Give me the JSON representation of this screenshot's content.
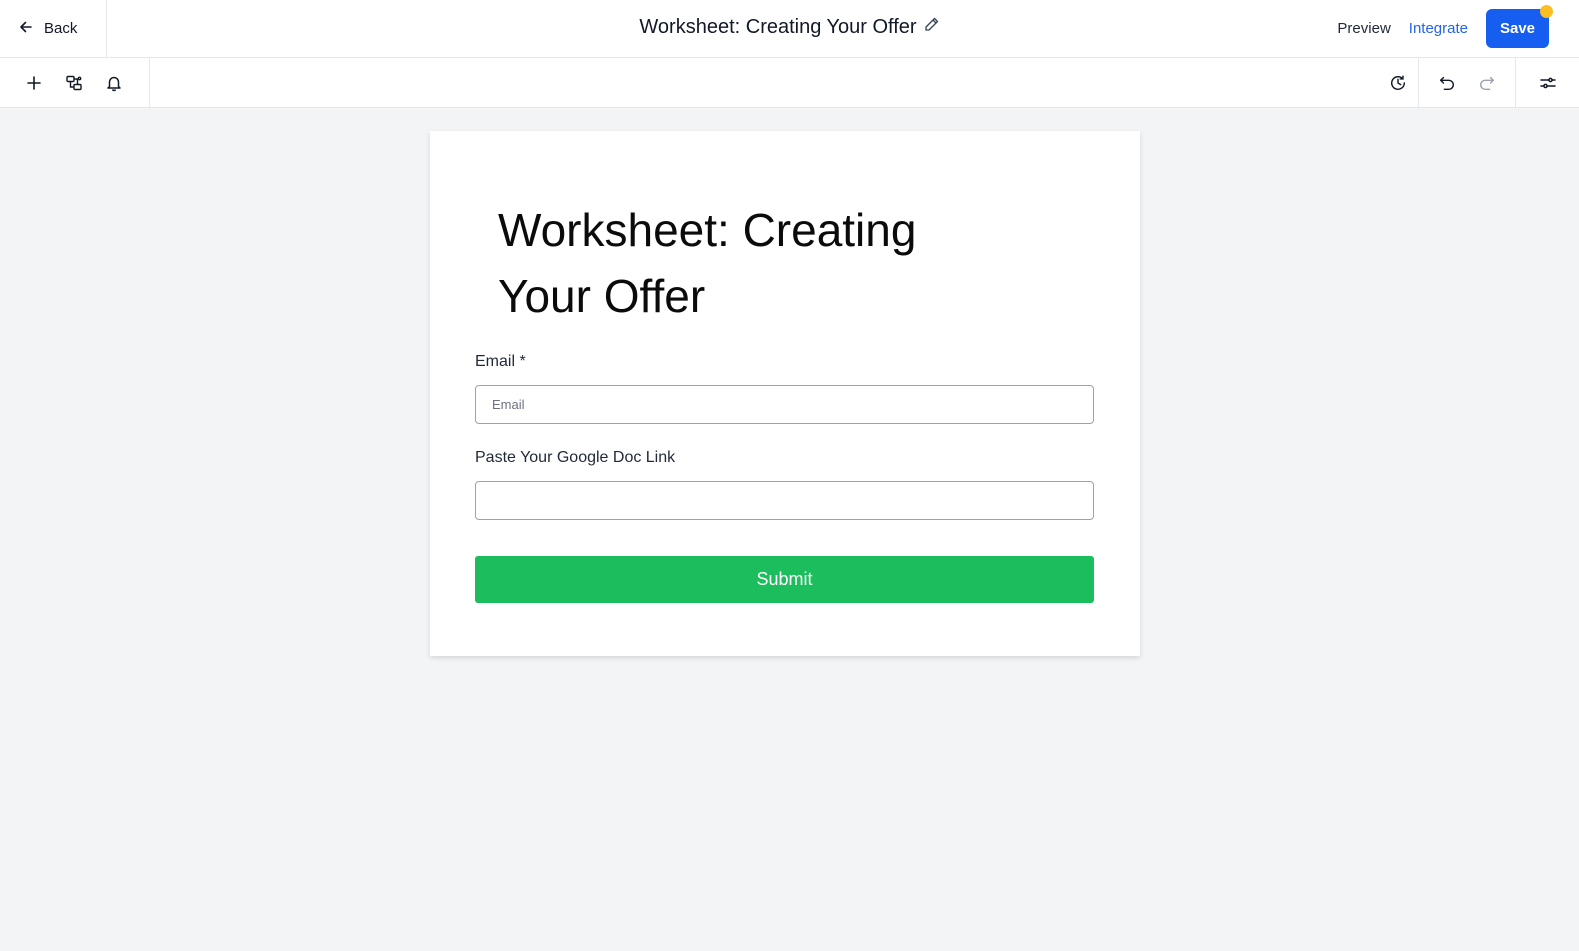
{
  "header": {
    "back_label": "Back",
    "title": "Worksheet: Creating Your Offer",
    "preview_label": "Preview",
    "integrate_label": "Integrate",
    "save_label": "Save"
  },
  "toolbar": {
    "left_icons": [
      "plus-icon",
      "layers-icon",
      "bell-icon"
    ],
    "right_icons": [
      "history-icon",
      "undo-icon",
      "redo-icon",
      "sliders-icon"
    ]
  },
  "form": {
    "title": "Worksheet: Creating Your Offer",
    "email_label": "Email *",
    "email_placeholder": "Email",
    "email_value": "",
    "doc_label": "Paste Your Google Doc Link",
    "doc_placeholder": "",
    "doc_value": "",
    "submit_label": "Submit"
  },
  "colors": {
    "save_button": "#155eef",
    "integrate_link": "#2563eb",
    "submit_button": "#1bbd5c",
    "unsaved_dot": "#fbbf24",
    "canvas_background": "#f3f4f6"
  }
}
